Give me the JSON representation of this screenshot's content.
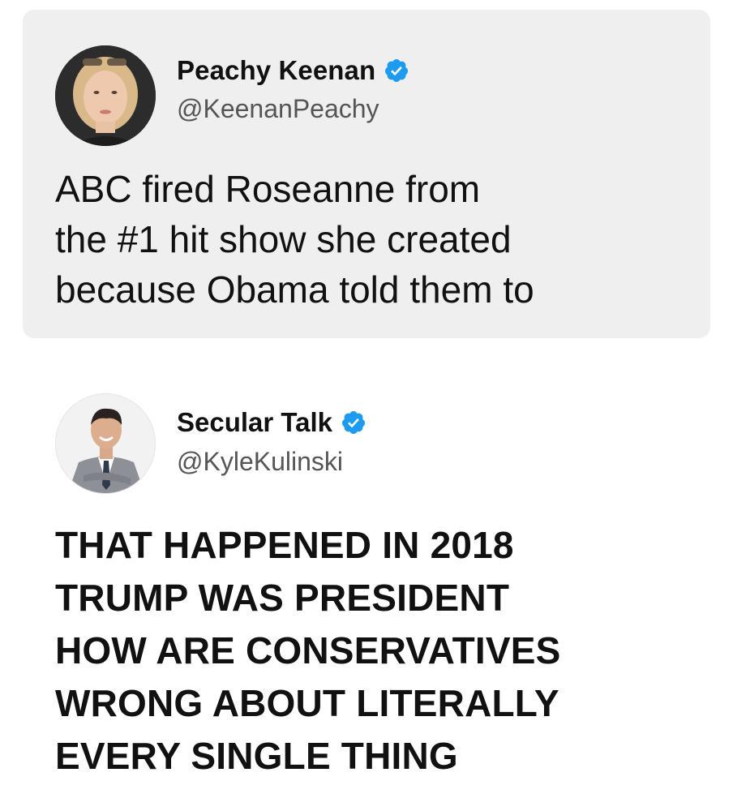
{
  "colors": {
    "card_background": "#efefef",
    "verified_badge": "#1d9bf0",
    "handle_text": "#555555",
    "body_text": "#111111"
  },
  "quoted_tweet": {
    "author_name": "Peachy Keenan",
    "handle": "@KeenanPeachy",
    "verified_icon": "verified-badge-icon",
    "text": "ABC fired Roseanne from\nthe #1 hit show she created\nbecause Obama told them to"
  },
  "reply_tweet": {
    "author_name": "Secular Talk",
    "handle": "@KyleKulinski",
    "verified_icon": "verified-badge-icon",
    "text": "THAT HAPPENED IN 2018\nTRUMP WAS PRESIDENT\nHOW ARE CONSERVATIVES\nWRONG ABOUT LITERALLY\nEVERY SINGLE THING"
  }
}
